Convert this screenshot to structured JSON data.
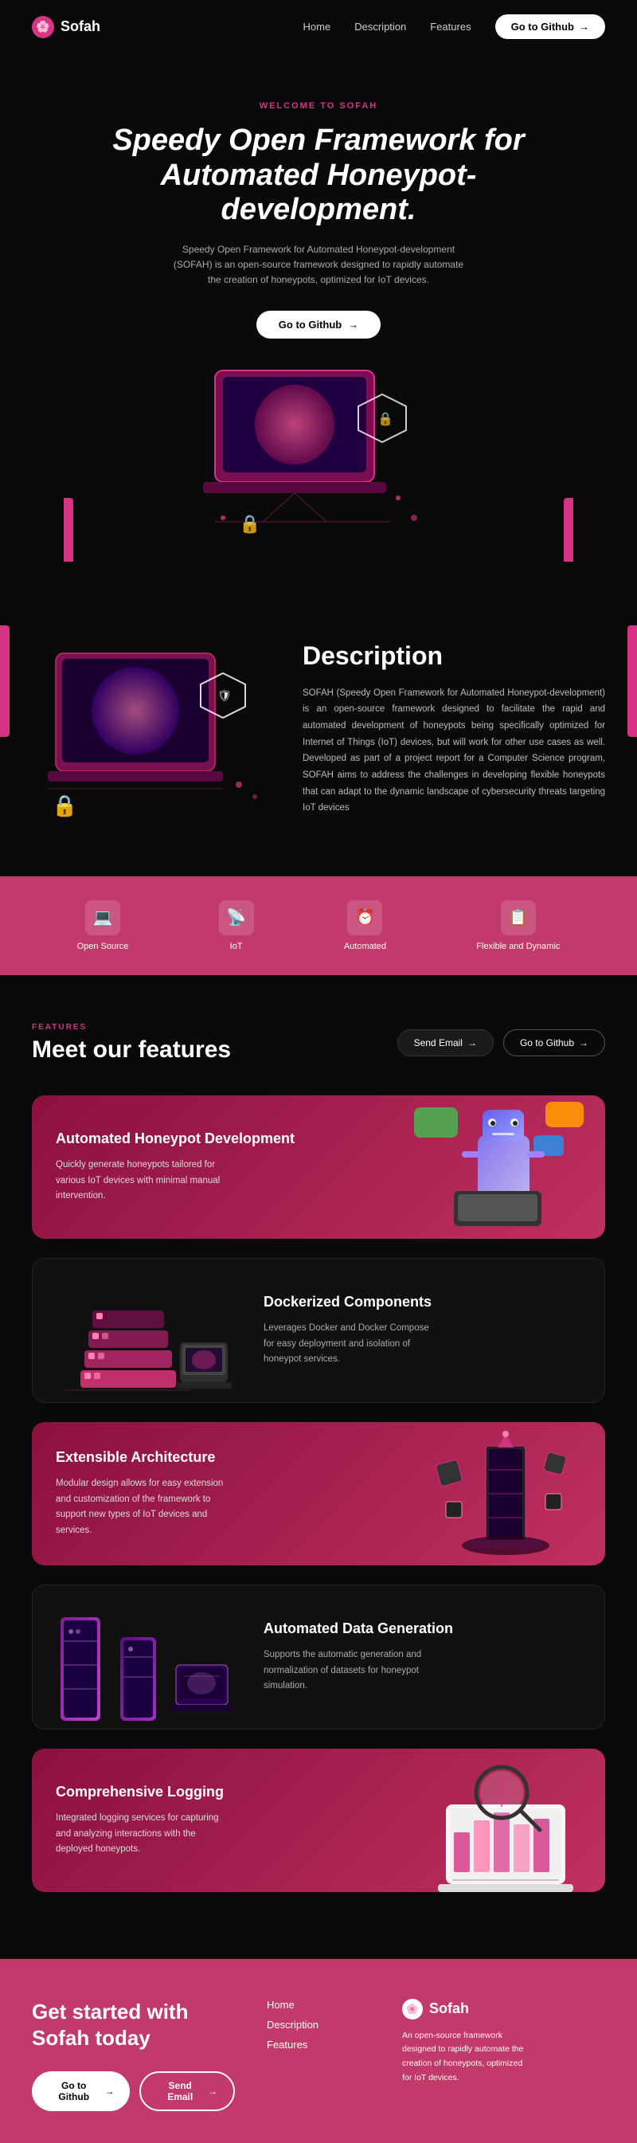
{
  "brand": {
    "name": "Sofah",
    "icon": "🌸"
  },
  "nav": {
    "links": [
      "Home",
      "Description",
      "Features"
    ],
    "cta": "Go to Github"
  },
  "hero": {
    "tag": "WELCOME TO SOFAH",
    "title": "Speedy Open Framework for Automated Honeypot-development.",
    "subtitle": "Speedy Open Framework for Automated Honeypot-development (SOFAH) is an open-source framework designed to rapidly automate the creation of honeypots, optimized for IoT devices.",
    "cta": "Go to Github"
  },
  "description": {
    "title": "Description",
    "body": "SOFAH (Speedy Open Framework for Automated Honeypot-development) is an open-source framework designed to facilitate the rapid and automated development of honeypots being specifically optimized for Internet of Things (IoT) devices, but will work for other use cases as well. Developed as part of a project report for a Computer Science program, SOFAH aims to address the challenges in developing flexible honeypots that can adapt to the dynamic landscape of cybersecurity threats targeting IoT devices"
  },
  "strip": {
    "items": [
      {
        "label": "Open Source",
        "icon": "💻"
      },
      {
        "label": "IoT",
        "icon": "📡"
      },
      {
        "label": "Automated",
        "icon": "⏰"
      },
      {
        "label": "Flexible and Dynamic",
        "icon": "📋"
      }
    ]
  },
  "features": {
    "tag": "FEATURES",
    "title": "Meet our features",
    "cta_email": "Send Email",
    "cta_github": "Go to Github",
    "items": [
      {
        "title": "Automated Honeypot Development",
        "desc": "Quickly generate honeypots tailored for various IoT devices with minimal manual intervention.",
        "style": "pink"
      },
      {
        "title": "Dockerized Components",
        "desc": "Leverages Docker and Docker Compose for easy deployment and isolation of honeypot services.",
        "style": "dark"
      },
      {
        "title": "Extensible Architecture",
        "desc": "Modular design allows for easy extension and customization of the framework to support new types of IoT devices and services.",
        "style": "pink"
      },
      {
        "title": "Automated Data Generation",
        "desc": "Supports the automatic generation and normalization of datasets for honeypot simulation.",
        "style": "dark"
      },
      {
        "title": "Comprehensive Logging",
        "desc": "Integrated logging services for capturing and analyzing interactions with the deployed honeypots.",
        "style": "pink"
      }
    ]
  },
  "footer": {
    "headline": "Get started with Sofah today",
    "cta_github": "Go to Github",
    "cta_email": "Send Email",
    "links": [
      "Home",
      "Description",
      "Features"
    ],
    "brand_desc": "An open-source framework designed to rapidly automate the creation of honeypots, optimized for IoT devices."
  }
}
